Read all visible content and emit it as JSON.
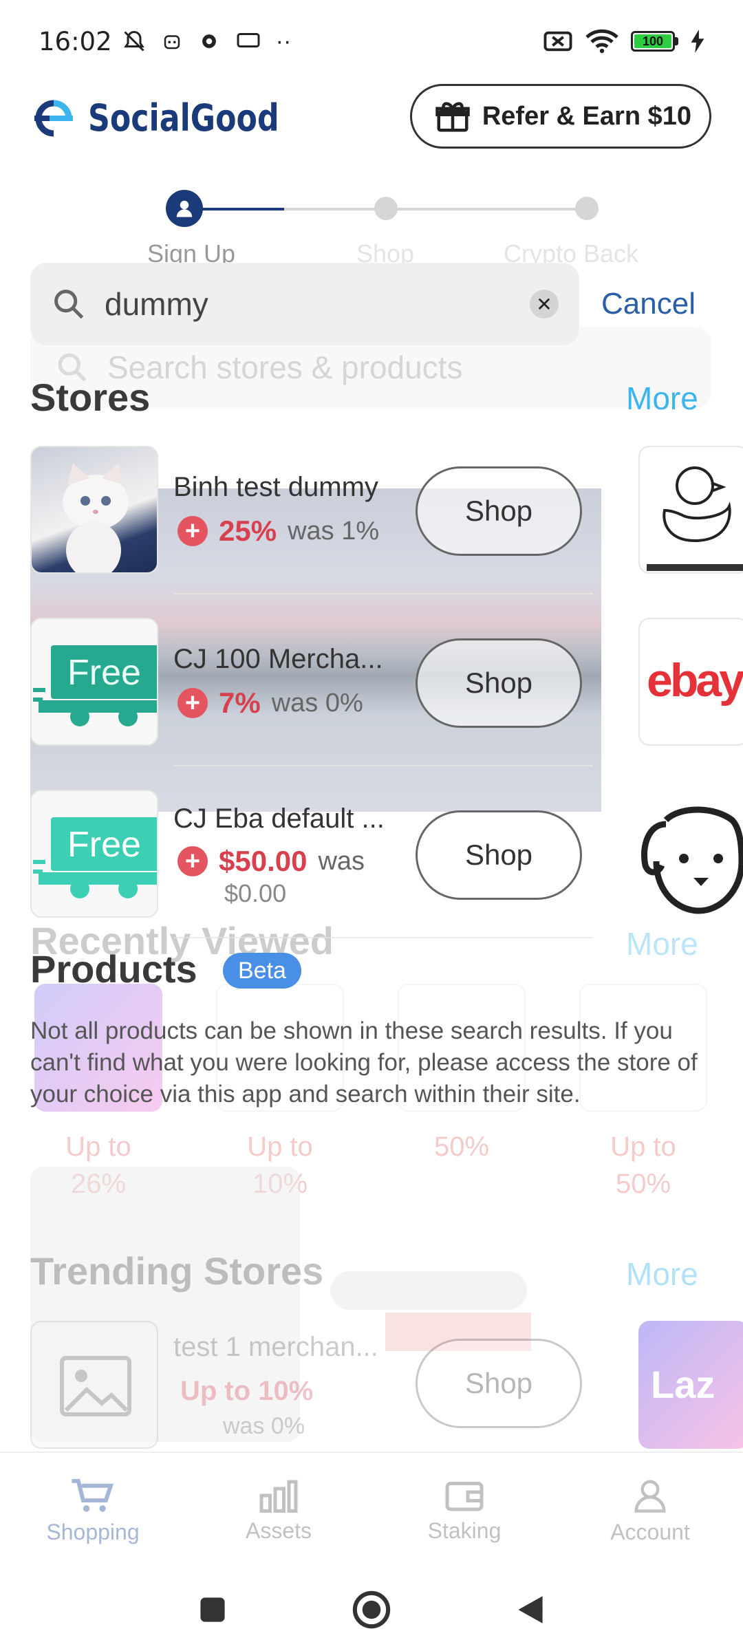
{
  "status_bar": {
    "time": "16:02",
    "battery": "100"
  },
  "header": {
    "brand": "SocialGood",
    "refer_label": "Refer & Earn $10"
  },
  "stepper": {
    "steps": [
      "Sign Up",
      "Shop",
      "Crypto Back"
    ]
  },
  "search": {
    "query": "dummy",
    "cancel": "Cancel",
    "ghost_placeholder": "Search stores & products"
  },
  "stores": {
    "title": "Stores",
    "more": "More",
    "items": [
      {
        "name": "Binh test dummy",
        "rate": "25%",
        "was": "was 1%",
        "shop": "Shop"
      },
      {
        "name": "CJ 100 Mercha...",
        "rate": "7%",
        "was": "was 0%",
        "shop": "Shop"
      },
      {
        "name": "CJ Eba default ...",
        "rate": "$50.00",
        "was": "was",
        "was2": "$0.00",
        "shop": "Shop"
      }
    ],
    "free_label": "Free",
    "ebay": "ebay"
  },
  "recently_viewed": {
    "title": "Recently Viewed",
    "more": "More",
    "items": [
      {
        "line1": "Up to",
        "line2": "26%"
      },
      {
        "line1": "Up to",
        "line2": "10%"
      },
      {
        "line1": "50%",
        "line2": ""
      },
      {
        "line1": "Up to",
        "line2": "50%"
      }
    ]
  },
  "products": {
    "title": "Products",
    "beta": "Beta",
    "disclaimer": "Not all products can be shown in these search results. If you can't find what you were looking for, please access the store of your choice via this app and search within their site."
  },
  "trending": {
    "title": "Trending Stores",
    "more": "More",
    "item": {
      "name": "test 1 merchan...",
      "rate": "Up to 10%",
      "was": "was 0%",
      "shop": "Shop"
    },
    "laz": "Laz"
  },
  "nav": {
    "items": [
      "Shopping",
      "Assets",
      "Staking",
      "Account"
    ]
  },
  "colors": {
    "brand": "#1b3a7a",
    "accent": "#3cb5ef",
    "rate": "#d6404f"
  }
}
